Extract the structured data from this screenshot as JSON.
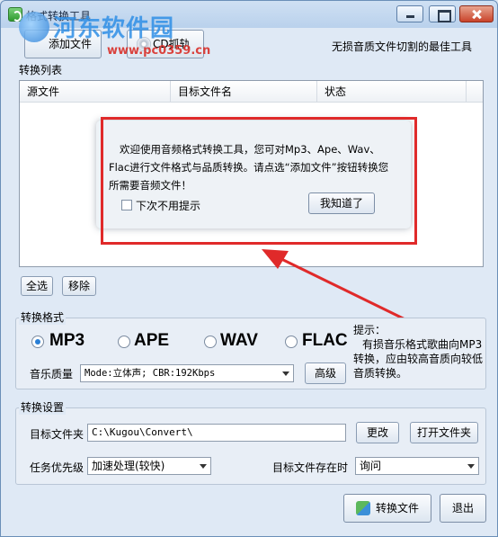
{
  "window": {
    "title": "格式转换工具"
  },
  "watermark": {
    "name": "河东软件园",
    "url": "www.pc0359.cn"
  },
  "toolbar": {
    "add_file_label": "添加文件",
    "cd_rip_label": "CD抓轨",
    "slogan": "无损音质文件切割的最佳工具"
  },
  "list": {
    "section_label": "转换列表",
    "columns": [
      "源文件",
      "目标文件名",
      "状态"
    ]
  },
  "dialog": {
    "message": "欢迎使用音频格式转换工具，您可对Mp3、Ape、Wav、Flac进行文件格式与品质转换。请点选“添加文件”按钮转换您所需要音频文件！",
    "dont_show_label": "下次不用提示",
    "dont_show_checked": false,
    "ok_label": "我知道了",
    "highlight_color": "#e02a2a"
  },
  "list_actions": {
    "select_all_label": "全选",
    "remove_label": "移除"
  },
  "format": {
    "section_label": "转换格式",
    "options": [
      "MP3",
      "APE",
      "WAV",
      "FLAC"
    ],
    "selected": "MP3",
    "quality_label": "音乐质量",
    "quality_value": "Mode:立体声; CBR:192Kbps",
    "advanced_label": "高级",
    "hint_title": "提示：",
    "hint_body": "有损音乐格式歌曲向MP3转换，应由较高音质向较低音质转换。"
  },
  "settings": {
    "section_label": "转换设置",
    "target_folder_label": "目标文件夹",
    "target_folder_value": "C:\\Kugou\\Convert\\",
    "change_label": "更改",
    "open_folder_label": "打开文件夹",
    "priority_label": "任务优先级",
    "priority_value": "加速处理(较快)",
    "exists_label": "目标文件存在时",
    "exists_value": "询问"
  },
  "footer": {
    "convert_label": "转换文件",
    "exit_label": "退出"
  },
  "colors": {
    "accent": "#2a7fd6",
    "annotation_red": "#e02a2a"
  }
}
